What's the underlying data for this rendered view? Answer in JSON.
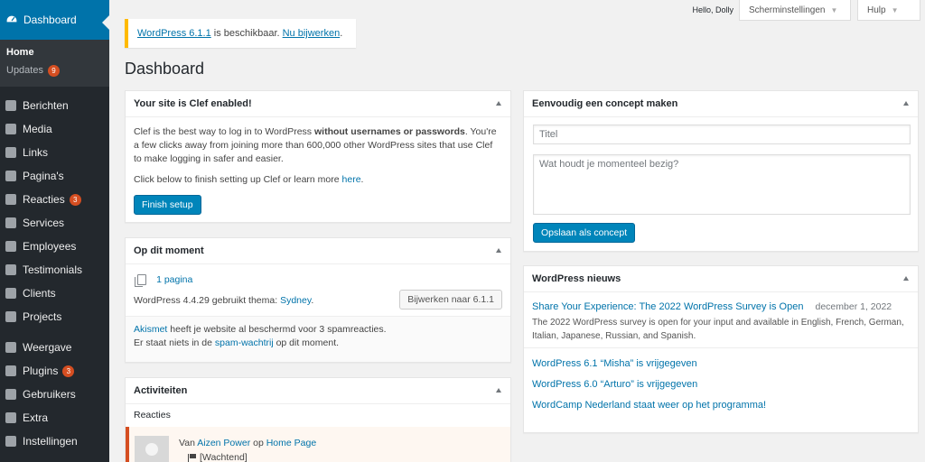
{
  "sidebar": {
    "dashboard_label": "Dashboard",
    "submenu": [
      {
        "label": "Home"
      },
      {
        "label": "Updates",
        "badge": "9"
      }
    ],
    "items": [
      {
        "label": "Berichten",
        "icon": "pin-icon"
      },
      {
        "label": "Media",
        "icon": "media-icon"
      },
      {
        "label": "Links",
        "icon": "link-icon"
      },
      {
        "label": "Pagina's",
        "icon": "pages-icon"
      },
      {
        "label": "Reacties",
        "icon": "comment-icon",
        "badge": "3"
      },
      {
        "label": "Services",
        "icon": "tag-icon"
      },
      {
        "label": "Employees",
        "icon": "briefcase-icon"
      },
      {
        "label": "Testimonials",
        "icon": "heart-icon"
      },
      {
        "label": "Clients",
        "icon": "person-icon"
      },
      {
        "label": "Projects",
        "icon": "document-icon"
      },
      {
        "label": "Weergave",
        "icon": "brush-icon"
      },
      {
        "label": "Plugins",
        "icon": "plug-icon",
        "badge": "3"
      },
      {
        "label": "Gebruikers",
        "icon": "users-icon"
      },
      {
        "label": "Extra",
        "icon": "wrench-icon"
      },
      {
        "label": "Instellingen",
        "icon": "settings-icon"
      }
    ]
  },
  "topbar": {
    "hello": "Hello, Dolly",
    "screen_options": "Scherminstellingen",
    "help": "Hulp"
  },
  "notice": {
    "version_link": "WordPress 6.1.1",
    "text": " is beschikbaar. ",
    "update_link": "Nu bijwerken",
    "end": "."
  },
  "page_title": "Dashboard",
  "clef_box": {
    "title": "Your site is Clef enabled!",
    "p1_a": "Clef is the best way to log in to WordPress ",
    "p1_bold": "without usernames or passwords",
    "p1_b": ". You're a few clicks away from joining more than 600,000 other WordPress sites that use Clef to make logging in safer and easier.",
    "p2_a": "Click below to finish setting up Clef or learn more ",
    "p2_link": "here",
    "p2_b": ".",
    "button": "Finish setup"
  },
  "glance_box": {
    "title": "Op dit moment",
    "pages": "1 pagina",
    "theme_text": "WordPress 4.4.29 gebruikt thema: ",
    "theme_link": "Sydney",
    "theme_end": ".",
    "update_button": "Bijwerken naar 6.1.1",
    "akismet_link": "Akismet",
    "akismet_text": " heeft je website al beschermd voor 3 spamreacties.",
    "queue_a": "Er staat niets in de ",
    "queue_link": "spam-wachtrij",
    "queue_b": " op dit moment."
  },
  "activity_box": {
    "title": "Activiteiten",
    "section": "Reacties",
    "from": "Van ",
    "author": "Aizen Power",
    "on": " op ",
    "post": "Home Page",
    "status": "[Wachtend]"
  },
  "draft_box": {
    "title": "Eenvoudig een concept maken",
    "title_placeholder": "Titel",
    "content_placeholder": "Wat houdt je momenteel bezig?",
    "save_button": "Opslaan als concept"
  },
  "news_box": {
    "title": "WordPress nieuws",
    "main_title": "Share Your Experience: The 2022 WordPress Survey is Open",
    "main_date": "december 1, 2022",
    "main_excerpt": "The 2022 WordPress survey is open for your input and available in English, French, German, Italian, Japanese, Russian, and Spanish.",
    "links": [
      "WordPress 6.1 “Misha” is vrijgegeven",
      "WordPress 6.0 “Arturo” is vrijgegeven",
      "WordCamp Nederland staat weer op het programma!"
    ]
  },
  "colors": {
    "sidebar_bg": "#23282d",
    "accent": "#0073aa",
    "badge": "#d54e21",
    "notice_border": "#ffba00"
  }
}
